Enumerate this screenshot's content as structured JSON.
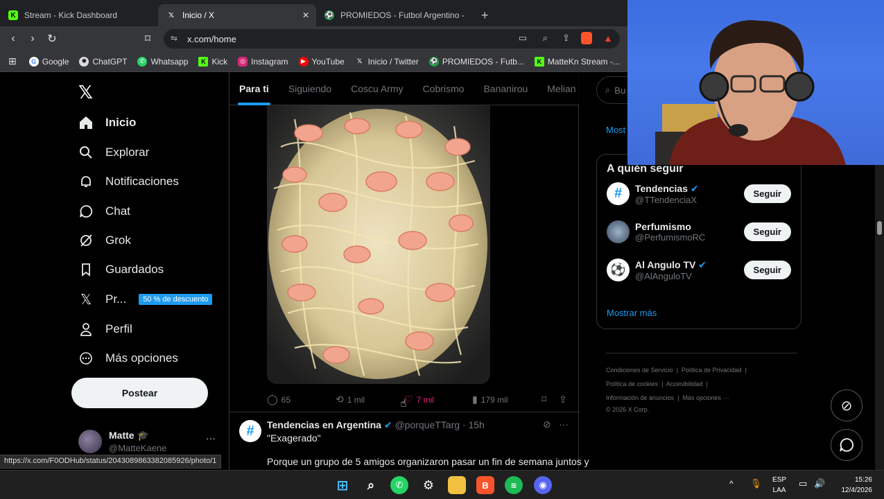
{
  "browser": {
    "tabs": [
      {
        "title": "Stream - Kick Dashboard",
        "icon": "kick-icon",
        "color": "#53fc18",
        "active": false
      },
      {
        "title": "Inicio / X",
        "icon": "x-icon",
        "color": "#ffffff",
        "active": true
      },
      {
        "title": "PROMIEDOS - Futbol Argentino - Fixt",
        "icon": "promiedos-icon",
        "color": "#1aa34a",
        "active": false
      }
    ],
    "url": "x.com/home",
    "bookmarks": [
      "Google",
      "ChatGPT",
      "Whatsapp",
      "Kick",
      "Instagram",
      "YouTube",
      "Inicio / Twitter",
      "PROMIEDOS - Futb...",
      "MatteKn Stream -..."
    ],
    "status_url": "https://x.com/F0ODHub/status/2043089863382085926/photo/1"
  },
  "sidebar": {
    "items": [
      {
        "label": "Inicio",
        "icon": "home-icon"
      },
      {
        "label": "Explorar",
        "icon": "search-icon"
      },
      {
        "label": "Notificaciones",
        "icon": "bell-icon"
      },
      {
        "label": "Chat",
        "icon": "chat-icon"
      },
      {
        "label": "Grok",
        "icon": "grok-icon"
      },
      {
        "label": "Guardados",
        "icon": "bookmark-icon"
      },
      {
        "label": "Pr...",
        "icon": "x-premium-icon"
      },
      {
        "label": "Perfil",
        "icon": "profile-icon"
      },
      {
        "label": "Más opciones",
        "icon": "more-icon"
      }
    ],
    "premium_badge": "50 % de descuento",
    "post_button": "Postear",
    "user": {
      "name": "Matte",
      "handle": "@MatteKaene"
    }
  },
  "feed": {
    "tabs": [
      "Para ti",
      "Siguiendo",
      "Coscu Army",
      "Cobrismo",
      "Bananirou",
      "Melian"
    ],
    "actions": {
      "replies": "65",
      "reposts": "1 mil",
      "likes": "7 mil",
      "views": "179 mil"
    },
    "next_post": {
      "author": "Tendencias en Argentina",
      "handle": "@porqueTTarg",
      "time": "· 15h",
      "title": "\"Exagerado\"",
      "text": "Porque un grupo de 5 amigos organizaron pasar un fin de semana juntos y"
    }
  },
  "right": {
    "search_placeholder": "Bu",
    "most_label": "Most",
    "follow_title": "A quién seguir",
    "suggestions": [
      {
        "name": "Tendencias",
        "handle": "@TTendenciaX",
        "verified": true,
        "button": "Seguir"
      },
      {
        "name": "Perfumismo",
        "handle": "@PerfumismoRC",
        "verified": false,
        "button": "Seguir"
      },
      {
        "name": "Al Angulo TV",
        "handle": "@AlAnguloTV",
        "verified": true,
        "button": "Seguir"
      }
    ],
    "show_more": "Mostrar más",
    "footer": [
      [
        "Condiciones de Servicio",
        "|",
        "Política de Privacidad",
        "|"
      ],
      [
        "Política de cookies",
        "|",
        "Accesibilidad",
        "|"
      ],
      [
        "Información de anuncios",
        "|",
        "Más opciones ···"
      ],
      [
        "© 2026 X Corp."
      ]
    ]
  },
  "taskbar": {
    "lang": "ESP",
    "layout": "LAA",
    "time": "15:26",
    "date": "12/4/2026"
  }
}
